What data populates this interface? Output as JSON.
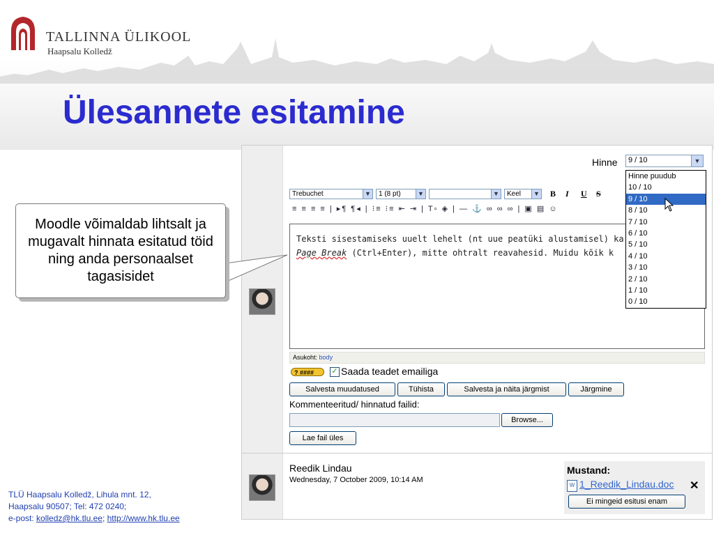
{
  "brand": {
    "university": "TALLINNA ÜLIKOOL",
    "college": "Haapsalu Kolledž",
    "logo_icon": "arch-logo-icon",
    "logo_color": "#b3262a"
  },
  "slide": {
    "title": "Ülesannete esitamine",
    "title_color": "#2b2bd0",
    "callout": "Moodle võimaldab lihtsalt ja mugavalt hinnata esitatud töid ning anda personaalset tagasisidet"
  },
  "grading": {
    "label": "Hinne",
    "selected": "9 / 10",
    "options": [
      "Hinne puudub",
      "10 / 10",
      "9 / 10",
      "8 / 10",
      "7 / 10",
      "6 / 10",
      "5 / 10",
      "4 / 10",
      "3 / 10",
      "2 / 10",
      "1 / 10",
      "0 / 10"
    ]
  },
  "editor_toolbar": {
    "font": "Trebuchet",
    "size": "1 (8 pt)",
    "style": "",
    "lang": "Keel",
    "bold": "B",
    "italic": "I",
    "underline": "U",
    "strike": "S",
    "row2_icons": "≡ ≡ ≡ ≡ | ▸¶ ¶◂ | ⁝≡ ⁝≡ ⇤ ⇥ | T▫ ◈ | — ⚓ ∞ ∞ ∞ | ▣ ▤ ☺"
  },
  "editor": {
    "line1": "Teksti sisestamiseks uuelt lehelt (nt uue peatüki alustamisel) ka",
    "line2_pb": "Page Break",
    "line2_rest": " (Ctrl+Enter), mitte ohtralt reavahesid. Muidu kõik k",
    "path_label": "Asukoht:",
    "path_value": "body"
  },
  "help_badge": "? ####",
  "email_checkbox": {
    "label": "Saada teadet emailiga",
    "checked": true
  },
  "buttons": {
    "save": "Salvesta muudatused",
    "cancel": "Tühista",
    "save_next": "Salvesta ja näita järgmist",
    "next": "Järgmine",
    "browse": "Browse...",
    "upload": "Lae fail üles",
    "no_more": "Ei mingeid esitusi enam"
  },
  "comment_files_label": "Kommenteeritud/ hinnatud failid:",
  "submission": {
    "name": "Reedik Lindau",
    "date": "Wednesday, 7 October 2009, 10:14 AM",
    "draft_label": "Mustand:",
    "file": "1_Reedik_Lindau.doc"
  },
  "footer": {
    "line1": "TLÜ Haapsalu Kolledž, Lihula mnt. 12,",
    "line2": "Haapsalu 90507; Tel: 472 0240;",
    "email_prefix": "e-post: ",
    "email": "kolledz@hk.tlu.ee",
    "sep": "; ",
    "url": "http://www.hk.tlu.ee"
  }
}
